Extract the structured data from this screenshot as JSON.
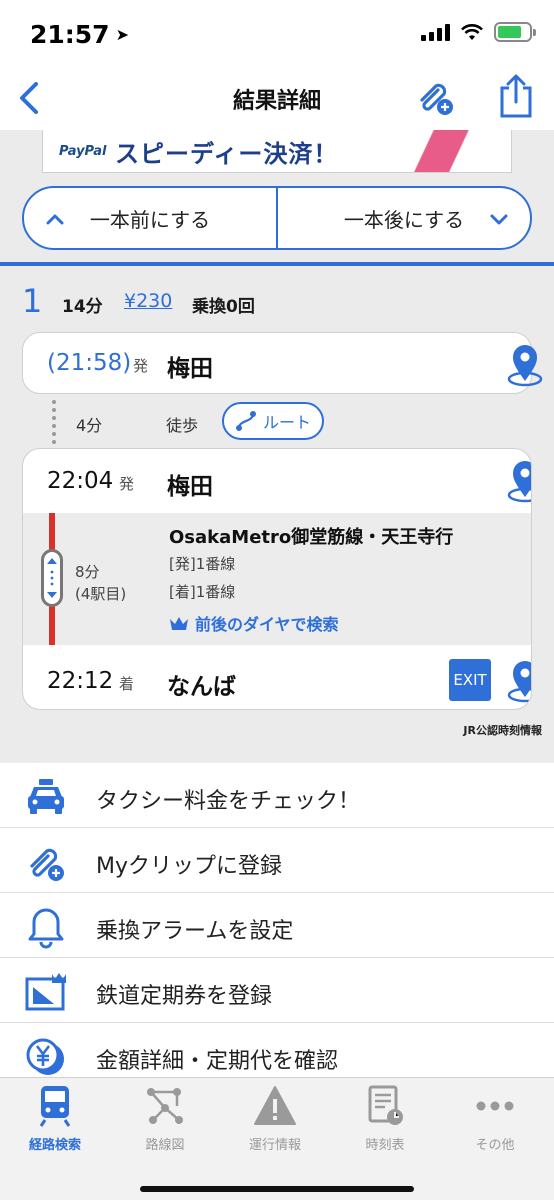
{
  "status_bar": {
    "time": "21:57"
  },
  "nav": {
    "title": "結果詳細",
    "back_icon": "chevron-left-icon",
    "clip_icon": "paperclip-plus-icon",
    "share_icon": "share-icon"
  },
  "banner": {
    "logo": "PayPal",
    "text": "スピーディー決済！"
  },
  "segment": {
    "prev_label": "一本前にする",
    "next_label": "一本後にする"
  },
  "summary": {
    "route_number": "1",
    "duration": "14分",
    "fare": "¥230",
    "transfers": "乗換0回"
  },
  "itinerary": {
    "start": {
      "time": "(21:58)",
      "kind": "発",
      "station": "梅田"
    },
    "walk": {
      "minutes": "4分",
      "mode": "徒歩",
      "route_button": "ルート"
    },
    "depart": {
      "time": "22:04",
      "kind": "発",
      "station": "梅田"
    },
    "ride": {
      "line": "OsakaMetro御堂筋線・天王寺行",
      "minutes": "8分",
      "stops": "(4駅目)",
      "depart_platform": "[発]1番線",
      "arrive_platform": "[着]1番線",
      "dia_search": "前後のダイヤで検索",
      "line_color": "#d8322c"
    },
    "arrive": {
      "time": "22:12",
      "kind": "着",
      "station": "なんば",
      "exit_label": "EXIT"
    }
  },
  "credit": "JR公認時刻情報",
  "menu": [
    {
      "label": "タクシー料金をチェック！",
      "icon": "taxi-icon"
    },
    {
      "label": "Myクリップに登録",
      "icon": "paperclip-plus-icon"
    },
    {
      "label": "乗換アラームを設定",
      "icon": "bell-icon"
    },
    {
      "label": "鉄道定期券を登録",
      "icon": "commuter-pass-icon"
    },
    {
      "label": "金額詳細・定期代を確認",
      "icon": "yen-coin-icon"
    }
  ],
  "tabs": [
    {
      "label": "経路検索",
      "icon": "train-icon",
      "active": true
    },
    {
      "label": "路線図",
      "icon": "route-map-icon",
      "active": false
    },
    {
      "label": "運行情報",
      "icon": "warning-icon",
      "active": false
    },
    {
      "label": "時刻表",
      "icon": "timetable-icon",
      "active": false
    },
    {
      "label": "その他",
      "icon": "more-icon",
      "active": false
    }
  ],
  "colors": {
    "accent": "#2f6fd8",
    "background_gray": "#ebebeb",
    "line_red": "#d8322c"
  }
}
